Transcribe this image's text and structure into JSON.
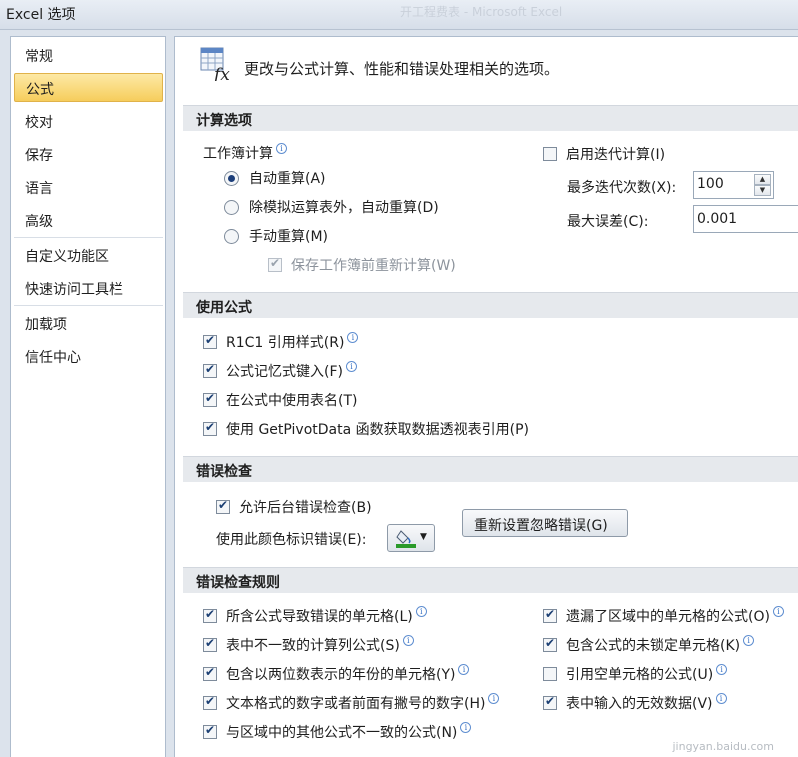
{
  "window": {
    "title": "Excel 选项",
    "background_title": "开工程费表 - Microsoft Excel"
  },
  "nav": [
    {
      "label": "常规"
    },
    {
      "label": "公式",
      "active": true
    },
    {
      "label": "校对"
    },
    {
      "label": "保存"
    },
    {
      "label": "语言"
    },
    {
      "label": "高级"
    },
    {
      "label": "自定义功能区"
    },
    {
      "label": "快速访问工具栏"
    },
    {
      "label": "加载项"
    },
    {
      "label": "信任中心"
    }
  ],
  "header": {
    "text": "更改与公式计算、性能和错误处理相关的选项。",
    "icon": "formula-fx-icon"
  },
  "calc": {
    "section_title": "计算选项",
    "workbook_label": "工作簿计算",
    "auto": "自动重算(A)",
    "auto_except": "除模拟运算表外，自动重算(D)",
    "manual": "手动重算(M)",
    "recalc_before_save": "保存工作簿前重新计算(W)",
    "iterative": "启用迭代计算(I)",
    "max_iterations_label": "最多迭代次数(X):",
    "max_iterations_value": "100",
    "max_change_label": "最大误差(C):",
    "max_change_value": "0.001"
  },
  "formulas": {
    "section_title": "使用公式",
    "r1c1": "R1C1 引用样式(R)",
    "autocomplete": "公式记忆式键入(F)",
    "table_names": "在公式中使用表名(T)",
    "getpivot": "使用 GetPivotData 函数获取数据透视表引用(P)"
  },
  "error_checking": {
    "section_title": "错误检查",
    "background": "允许后台错误检查(B)",
    "color_label": "使用此颜色标识错误(E):",
    "reset_button": "重新设置忽略错误(G)",
    "color": "#2a9a2a"
  },
  "rules": {
    "section_title": "错误检查规则",
    "left": [
      {
        "label": "所含公式导致错误的单元格(L)",
        "checked": true
      },
      {
        "label": "表中不一致的计算列公式(S)",
        "checked": true
      },
      {
        "label": "包含以两位数表示的年份的单元格(Y)",
        "checked": true
      },
      {
        "label": "文本格式的数字或者前面有撇号的数字(H)",
        "checked": true
      },
      {
        "label": "与区域中的其他公式不一致的公式(N)",
        "checked": true
      }
    ],
    "right": [
      {
        "label": "遗漏了区域中的单元格的公式(O)",
        "checked": true
      },
      {
        "label": "包含公式的未锁定单元格(K)",
        "checked": true
      },
      {
        "label": "引用空单元格的公式(U)",
        "checked": false
      },
      {
        "label": "表中输入的无效数据(V)",
        "checked": true
      }
    ]
  },
  "watermark": "jingyan.baidu.com",
  "colors": {
    "active_nav": "#f6cd5c",
    "section_bg": "#e6e9ed"
  }
}
